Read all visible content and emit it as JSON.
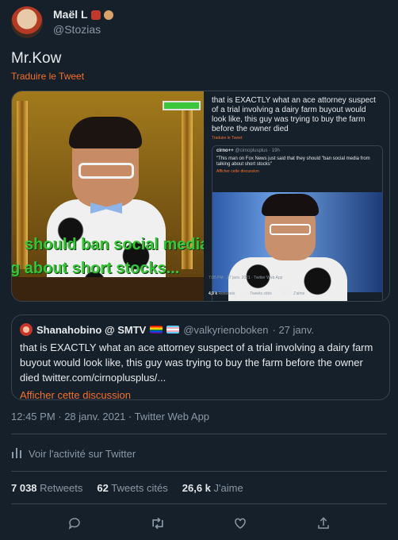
{
  "author": {
    "display_name": "Maël L",
    "handle": "@Stozias"
  },
  "tweet": {
    "text": "Mr.Kow",
    "translate_label": "Traduire le Tweet"
  },
  "media": {
    "left": {
      "caption_line1": "should ban social media fr",
      "caption_line2": "g about short stocks..."
    },
    "right": {
      "text": "that is EXACTLY what an ace attorney suspect of a trial involving a dairy farm buyout would look like, this guy was trying to buy the farm before the owner died",
      "translate": "Traduire le Tweet",
      "quote_name": "cirno++",
      "quote_handle": "@cirnoplusplus · 19h",
      "quote_text": "\"This man on Fox News just said that they should \"ban social media from talking about short stocks\"",
      "quote_link": "Afficher cette discussion",
      "meta": "7:05 PM · 27 janv. 2021 · Twitter Web App",
      "retweets_count": "4,9 k",
      "retweets_label": "Retweets",
      "quotes_count": "27",
      "quotes_label": "Tweets cités",
      "likes_count": "18,9 k",
      "likes_label": "J'aime"
    }
  },
  "quoted_tweet": {
    "name": "Shanahobino @ SMTV",
    "handle": "@valkyrienoboken",
    "date": "· 27 janv.",
    "text": "that is EXACTLY what an ace attorney suspect of a trial involving a dairy farm buyout would look like, this guy was trying to buy the farm before the owner died twitter.com/cirnoplusplus/...",
    "show_thread": "Afficher cette discussion"
  },
  "timestamp": "12:45 PM · 28 janv. 2021 · Twitter Web App",
  "activity_label": "Voir l'activité sur Twitter",
  "stats": {
    "retweets_count": "7 038",
    "retweets_label": "Retweets",
    "quotes_count": "62",
    "quotes_label": "Tweets cités",
    "likes_count": "26,6 k",
    "likes_label": "J'aime"
  },
  "icons": [
    "reply-icon",
    "retweet-icon",
    "like-icon",
    "share-icon",
    "activity-icon"
  ],
  "colors": {
    "background": "#15202b",
    "accent": "#f4702a",
    "muted": "#8b98a5",
    "border": "#38444d"
  }
}
